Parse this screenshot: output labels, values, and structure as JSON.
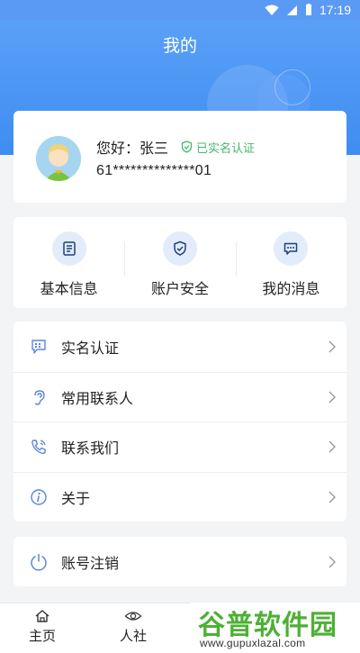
{
  "status_bar": {
    "time": "17:19"
  },
  "header": {
    "title": "我的"
  },
  "profile": {
    "greeting": "您好：张三",
    "verified_label": "已实名认证",
    "id_number": "61**************01"
  },
  "quick_actions": [
    {
      "label": "基本信息",
      "icon": "document-icon"
    },
    {
      "label": "账户安全",
      "icon": "shield-icon"
    },
    {
      "label": "我的消息",
      "icon": "message-icon"
    }
  ],
  "menu": [
    {
      "label": "实名认证",
      "icon": "id-card-icon"
    },
    {
      "label": "常用联系人",
      "icon": "ear-icon"
    },
    {
      "label": "联系我们",
      "icon": "phone-icon"
    },
    {
      "label": "关于",
      "icon": "info-icon"
    }
  ],
  "logout": {
    "label": "账号注销",
    "icon": "power-icon"
  },
  "tabbar": [
    {
      "label": "主页",
      "icon": "home-icon"
    },
    {
      "label": "人社",
      "icon": "eye-icon"
    }
  ],
  "watermark": {
    "name": "谷普软件园",
    "url": "www.gupuxlazal.com"
  },
  "colors": {
    "primary": "#3f8df1",
    "verified": "#44b86b",
    "icon_bg": "#e2ecfb",
    "icon_stroke": "#3a6fd0"
  }
}
